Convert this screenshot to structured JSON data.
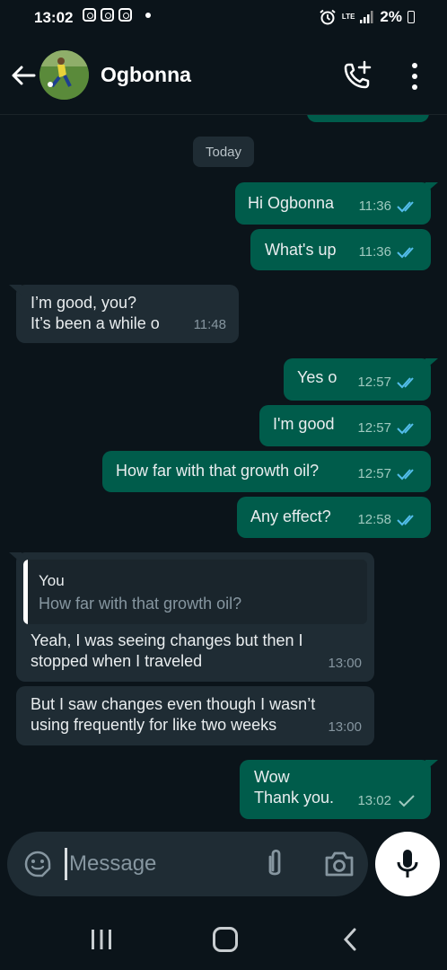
{
  "status_bar": {
    "time": "13:02",
    "network": "LTE",
    "battery": "2%"
  },
  "header": {
    "contact_name": "Ogbonna",
    "icons": [
      "back-arrow-icon",
      "avatar",
      "add-call-icon",
      "more-vert-icon"
    ]
  },
  "chat": {
    "date_label": "Today",
    "messages": [
      {
        "dir": "out",
        "text": "Hi Ogbonna",
        "time": "11:36",
        "status": "read"
      },
      {
        "dir": "out",
        "text": "What's up",
        "time": "11:36",
        "status": "read"
      },
      {
        "dir": "in",
        "text": "I’m good, you?\nIt’s been a while o",
        "time": "11:48"
      },
      {
        "dir": "out",
        "text": "Yes o",
        "time": "12:57",
        "status": "read"
      },
      {
        "dir": "out",
        "text": "I'm good",
        "time": "12:57",
        "status": "read"
      },
      {
        "dir": "out",
        "text": "How far with that growth oil?",
        "time": "12:57",
        "status": "read"
      },
      {
        "dir": "out",
        "text": "Any effect?",
        "time": "12:58",
        "status": "read"
      },
      {
        "dir": "in",
        "reply_author": "You",
        "reply_text": "How far with that growth oil?",
        "text": "Yeah, I was seeing changes but then I\nstopped when I traveled",
        "time": "13:00"
      },
      {
        "dir": "in",
        "text": "But I saw changes even though I wasn’t\nusing frequently for like two weeks",
        "time": "13:00"
      },
      {
        "dir": "out",
        "text": "Wow\nThank you.",
        "time": "13:02",
        "status": "sent"
      }
    ]
  },
  "composer": {
    "placeholder": "Message",
    "icons": [
      "emoji-sticker-icon",
      "attach-icon",
      "camera-icon",
      "mic-icon"
    ]
  },
  "colors": {
    "background": "#0b141a",
    "outgoing_bubble": "#005c4b",
    "incoming_bubble": "#1f2c34",
    "read_tick": "#53bdeb"
  }
}
